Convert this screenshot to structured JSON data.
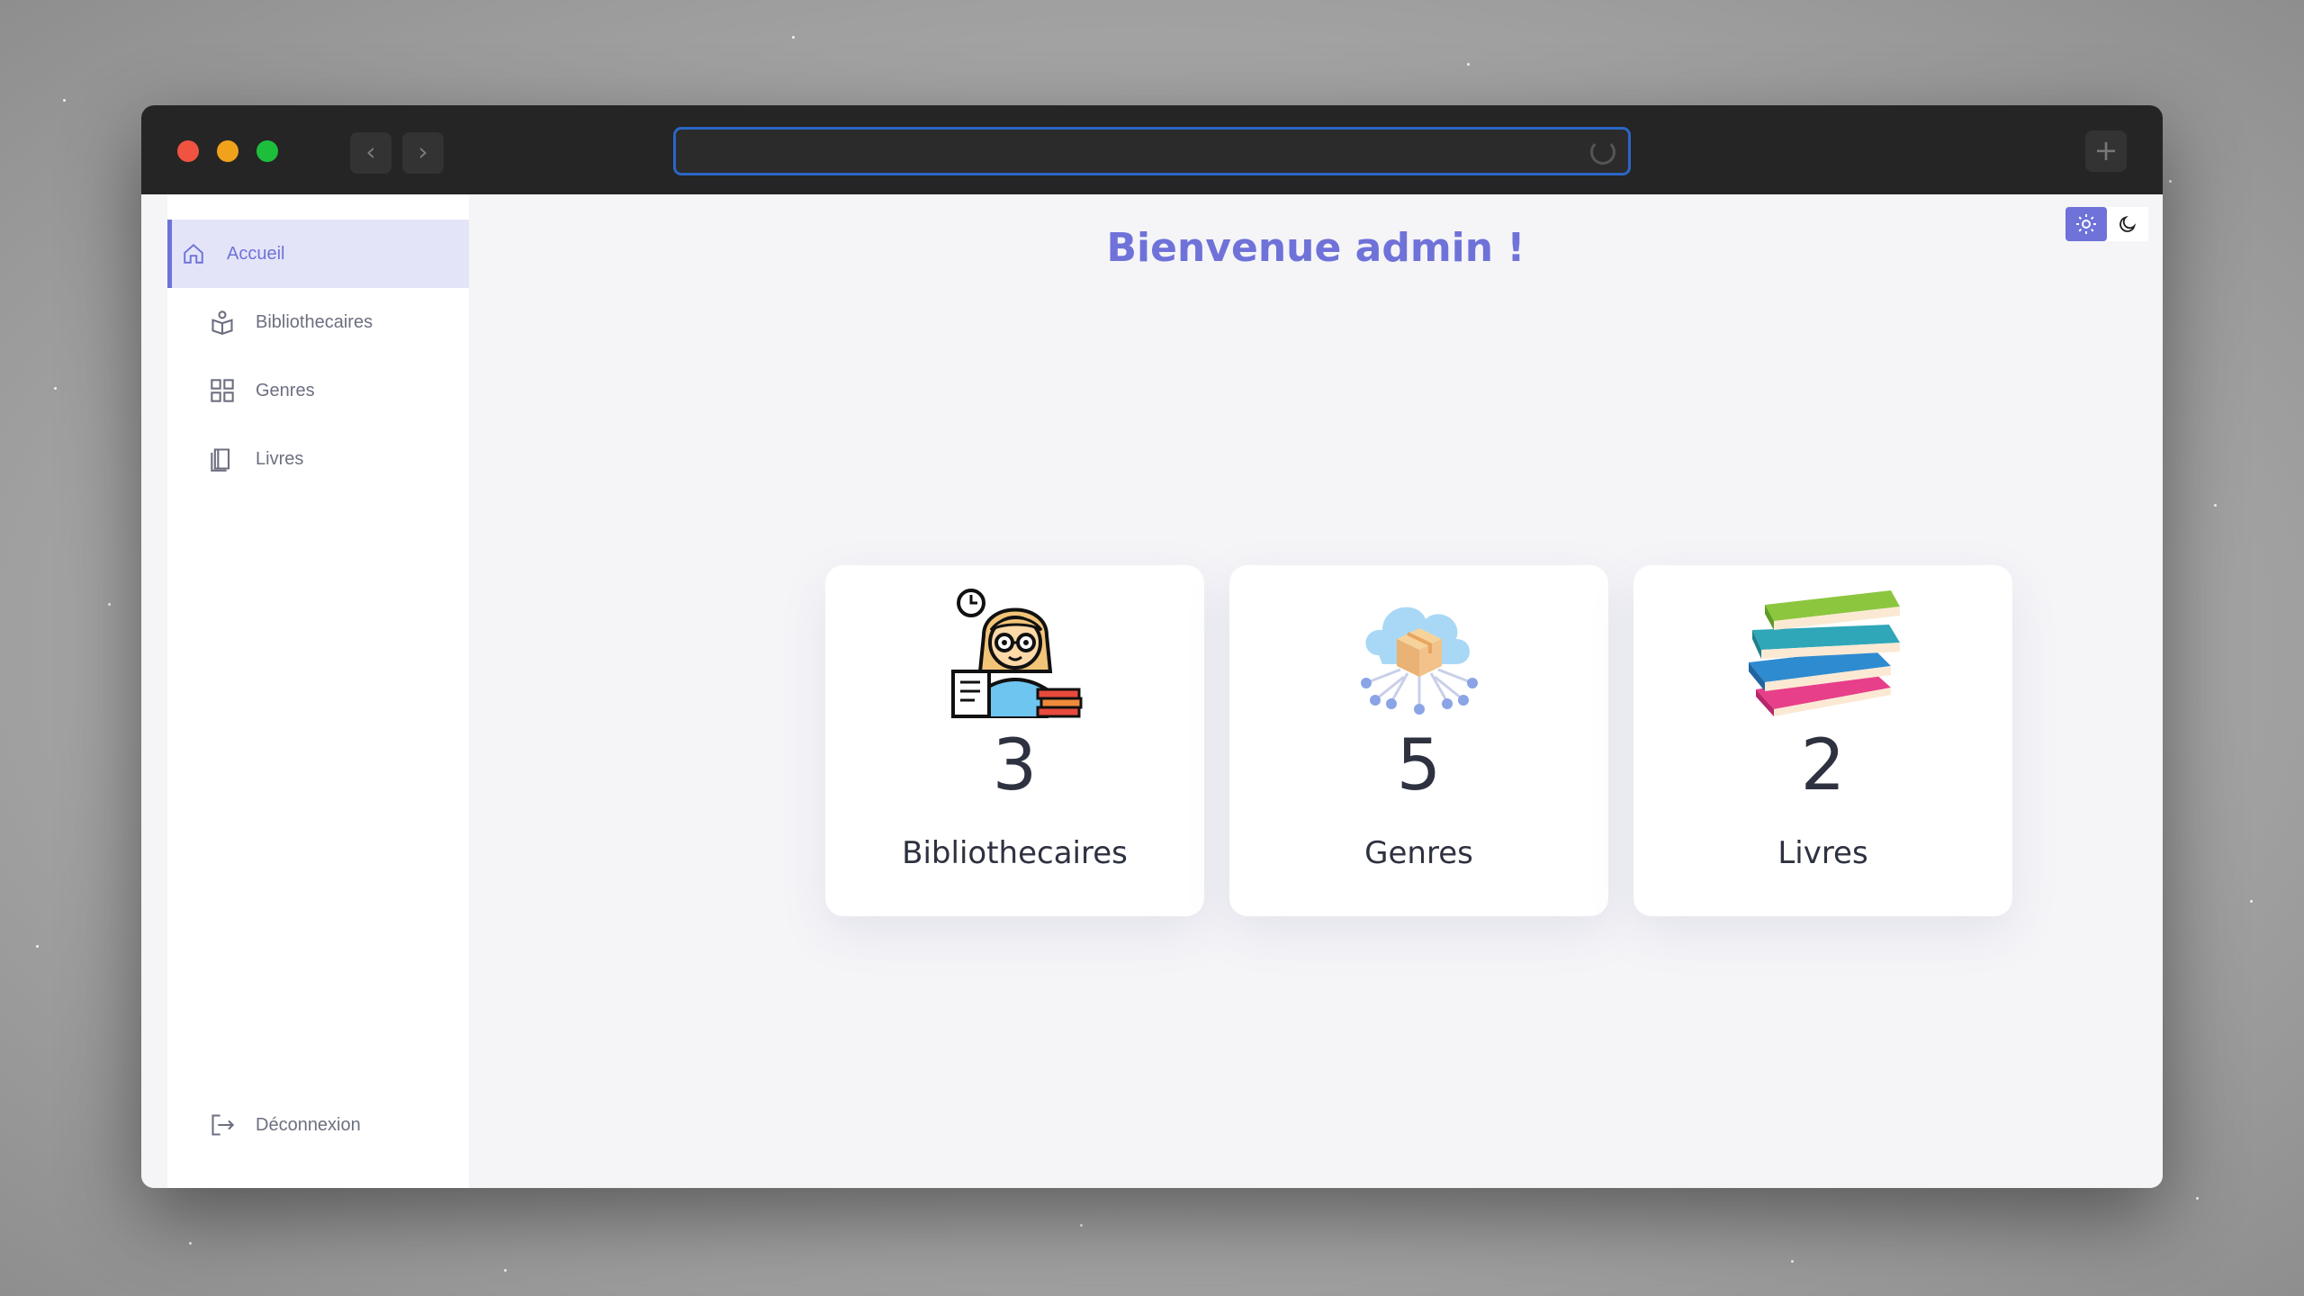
{
  "browser": {
    "back_icon": "chevron-left-icon",
    "forward_icon": "chevron-right-icon",
    "url": "",
    "new_tab_icon": "plus-icon"
  },
  "sidebar": {
    "items": [
      {
        "label": "Accueil",
        "icon": "home-icon",
        "active": true
      },
      {
        "label": "Bibliothecaires",
        "icon": "librarian-icon",
        "active": false
      },
      {
        "label": "Genres",
        "icon": "grid-icon",
        "active": false
      },
      {
        "label": "Livres",
        "icon": "book-icon",
        "active": false
      }
    ],
    "logout": {
      "label": "Déconnexion",
      "icon": "logout-icon"
    }
  },
  "theme": {
    "light_icon": "sun-icon",
    "dark_icon": "moon-icon",
    "selected": "light"
  },
  "main": {
    "welcome": "Bienvenue admin !",
    "cards": [
      {
        "value": "3",
        "label": "Bibliothecaires",
        "icon": "librarian-illustration"
      },
      {
        "value": "5",
        "label": "Genres",
        "icon": "cloud-box-illustration"
      },
      {
        "value": "2",
        "label": "Livres",
        "icon": "books-stack-illustration"
      }
    ]
  },
  "colors": {
    "accent": "#6f72d8",
    "text": "#2e3140",
    "titlebar": "#252525",
    "background": "#f5f5f8"
  }
}
